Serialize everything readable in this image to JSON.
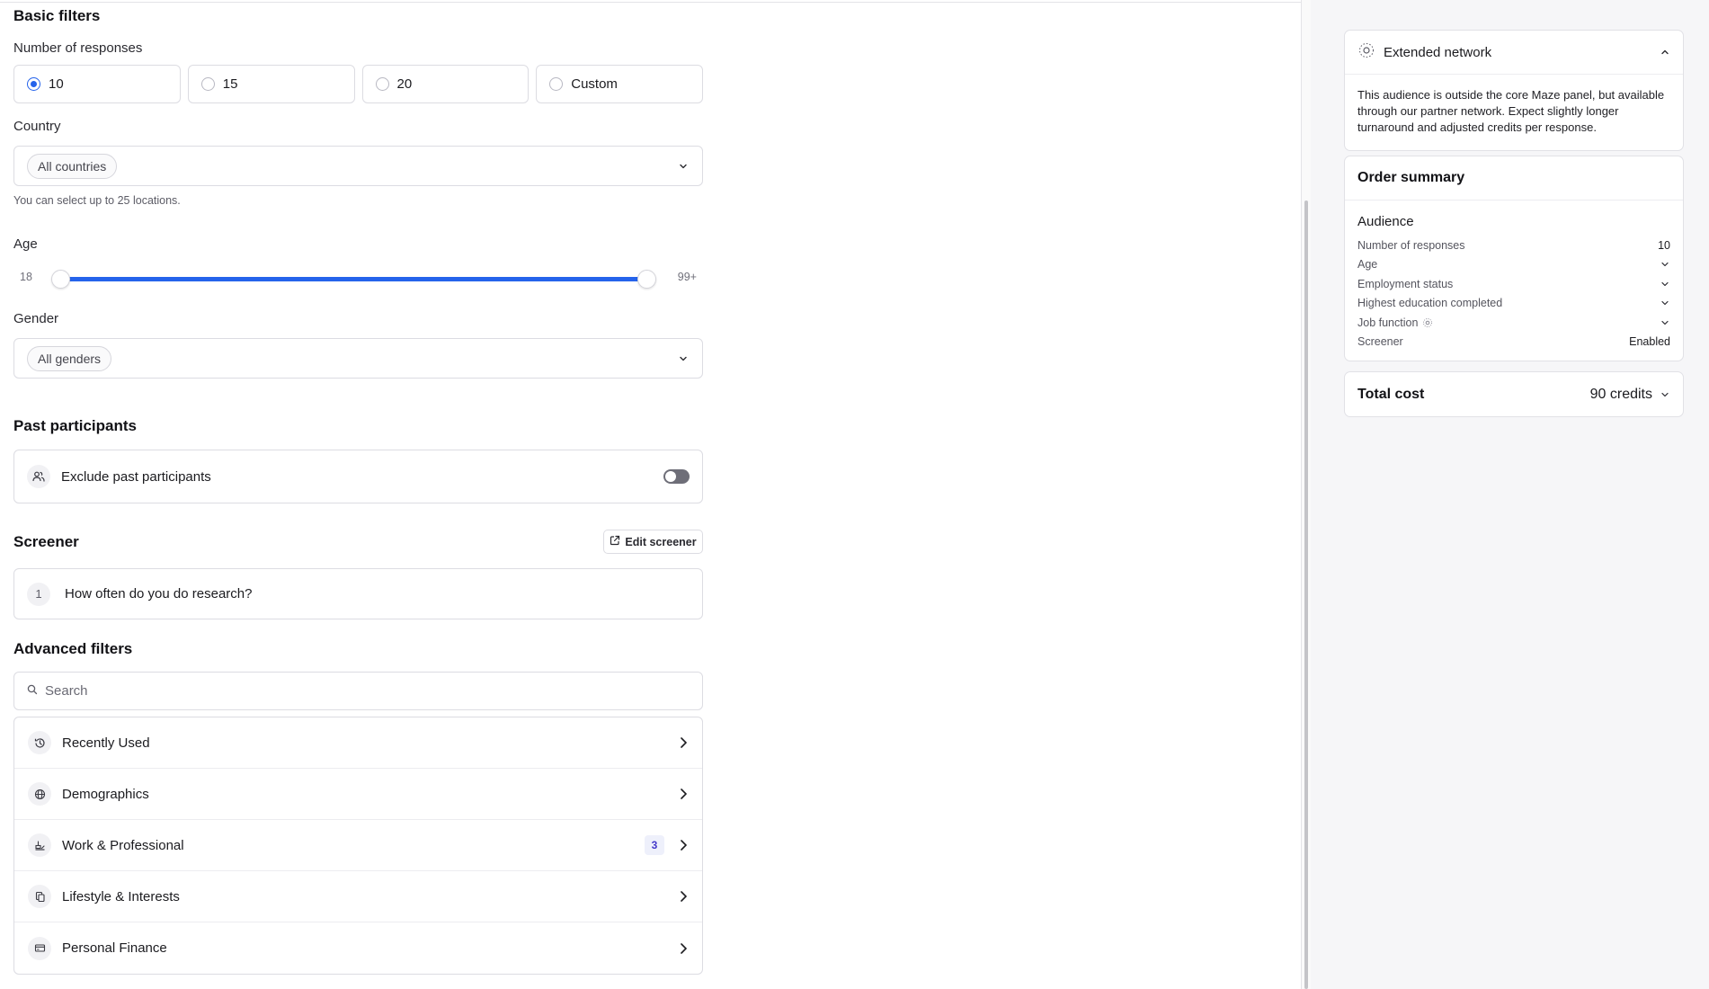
{
  "basic_filters": {
    "title": "Basic filters",
    "responses_label": "Number of responses",
    "response_options": [
      {
        "label": "10",
        "selected": true
      },
      {
        "label": "15",
        "selected": false
      },
      {
        "label": "20",
        "selected": false
      },
      {
        "label": "Custom",
        "selected": false
      }
    ],
    "country_label": "Country",
    "country_value": "All countries",
    "country_helper": "You can select up to 25 locations.",
    "age_label": "Age",
    "age_min": "18",
    "age_max": "99+",
    "age_range_fraction": [
      0.0,
      1.0
    ],
    "gender_label": "Gender",
    "gender_value": "All genders"
  },
  "past_participants": {
    "title": "Past participants",
    "exclude_label": "Exclude past participants",
    "exclude_enabled": false
  },
  "screener": {
    "title": "Screener",
    "edit_label": "Edit screener",
    "questions": [
      {
        "number": "1",
        "text": "How often do you do research?"
      }
    ]
  },
  "advanced_filters": {
    "title": "Advanced filters",
    "search_placeholder": "Search",
    "categories": [
      {
        "label": "Recently Used",
        "icon": "history-icon"
      },
      {
        "label": "Demographics",
        "icon": "globe-icon"
      },
      {
        "label": "Work & Professional",
        "icon": "briefcase-icon",
        "count": "3"
      },
      {
        "label": "Lifestyle & Interests",
        "icon": "lifestyle-icon"
      },
      {
        "label": "Personal Finance",
        "icon": "credit-card-icon"
      }
    ]
  },
  "extended_network": {
    "title": "Extended network",
    "description": "This audience is outside the core Maze panel, but available through our partner network. Expect slightly longer turnaround and adjusted credits per response."
  },
  "order_summary": {
    "title": "Order summary",
    "audience_label": "Audience",
    "rows": [
      {
        "label": "Number of responses",
        "value": "10"
      },
      {
        "label": "Age",
        "value": ""
      },
      {
        "label": "Employment status",
        "value": ""
      },
      {
        "label": "Highest education completed",
        "value": ""
      },
      {
        "label": "Job function",
        "value": ""
      },
      {
        "label": "Screener",
        "value": "Enabled"
      }
    ]
  },
  "total_cost": {
    "label": "Total cost",
    "value": "90 credits"
  },
  "colors": {
    "accent": "#2563eb",
    "badge_text": "#4338ca",
    "toggle_off": "#6e6e78"
  }
}
